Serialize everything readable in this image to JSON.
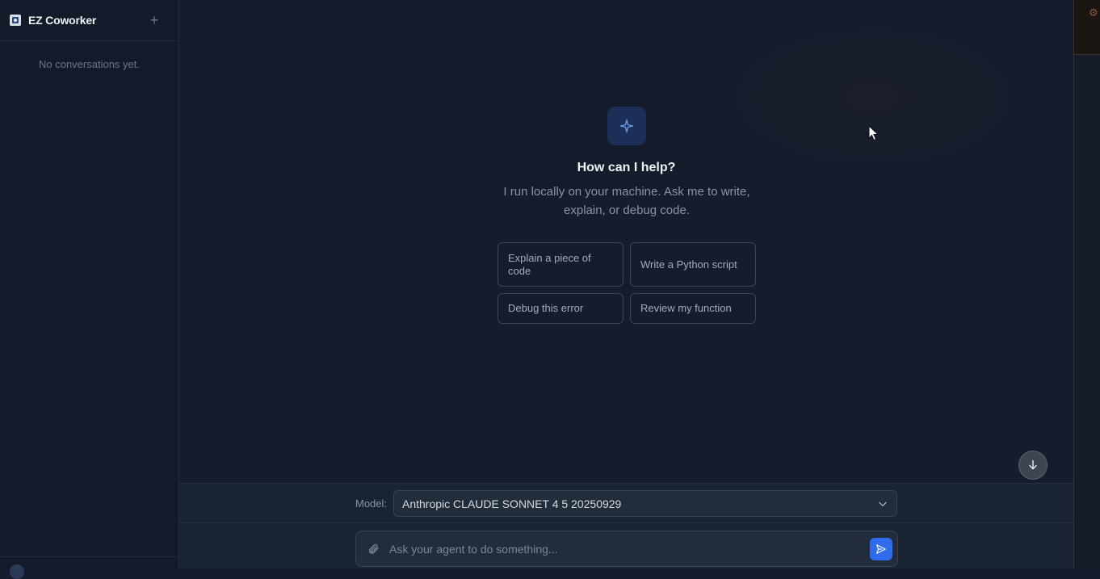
{
  "sidebar": {
    "app_title": "EZ Coworker",
    "new_chat_symbol": "+",
    "empty_text": "No conversations yet."
  },
  "hero": {
    "icon": "sparkle-icon",
    "title": "How can I help?",
    "subtitle": "I run locally on your machine. Ask me to write, explain, or debug code."
  },
  "suggestions": [
    {
      "label": "Explain a piece of code"
    },
    {
      "label": "Write a Python script"
    },
    {
      "label": "Debug this error"
    },
    {
      "label": "Review my function"
    }
  ],
  "model": {
    "label": "Model:",
    "selected": "Anthropic CLAUDE SONNET 4 5 20250929"
  },
  "composer": {
    "placeholder": "Ask your agent to do something..."
  },
  "right_panel": {
    "gear_symbol": "⚙"
  },
  "colors": {
    "accent": "#2f6bea",
    "background": "#151d2d",
    "sidebar": "#131b2b"
  }
}
